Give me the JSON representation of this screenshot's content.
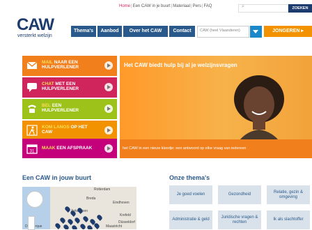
{
  "toplinks": [
    {
      "label": "Home",
      "active": true
    },
    {
      "label": "Een CAW in je buurt",
      "active": false
    },
    {
      "label": "Materiaal",
      "active": false
    },
    {
      "label": "Pers",
      "active": false
    },
    {
      "label": "FAQ",
      "active": false
    }
  ],
  "search": {
    "placeholder": "",
    "button_label": "ZOEKEN"
  },
  "logo": {
    "name": "CAW",
    "tagline": "versterkt welzijn"
  },
  "nav": {
    "items": [
      "Thema's",
      "Aanbod",
      "Over het CAW",
      "Contact"
    ],
    "select_value": "CAW (heel Vlaanderen)",
    "jongeren_label": "JONGEREN"
  },
  "contact_bars": [
    {
      "highlight": "MAIL",
      "rest1": " NAAR EEN",
      "line2": "HULPVERLENER",
      "color": "#f07f1c",
      "icon": "mail-icon"
    },
    {
      "highlight": "CHAT",
      "rest1": " MET EEN",
      "line2": "HULPVERLENER",
      "color": "#d0245d",
      "icon": "chat-icon"
    },
    {
      "highlight": "BEL",
      "rest1": " EEN",
      "line2": "HULPVERLENER",
      "color": "#9dc21a",
      "icon": "phone-icon"
    },
    {
      "highlight": "KOM LANGS",
      "rest1": " OP HET",
      "line2": "CAW",
      "color": "#f39200",
      "icon": "walk-icon"
    },
    {
      "highlight": "MAAK",
      "rest1": " EEN AFSPRAAK",
      "line2": "",
      "color": "#c4007a",
      "icon": "calendar-icon"
    }
  ],
  "hero": {
    "title": "Het CAW biedt hulp bij al je welzijnsvragen",
    "caption": "het CAW in een nieuw kleedje: een antwoord op elke vraag van iedereen"
  },
  "sections": {
    "map_title": "Een CAW in jouw buurt",
    "themes_title": "Onze thema's"
  },
  "map_labels": [
    "Rotterdam",
    "Breda",
    "Eindhoven",
    "Antwerpen",
    "Krefeld",
    "Düsseldorf",
    "Dunkerque",
    "Maastricht"
  ],
  "themes": [
    "Je goed voelen",
    "Gezondheid",
    "Relatie, gezin & omgeving",
    "Administratie & geld",
    "Juridische vragen & rechten",
    "Ik als slachtoffer"
  ],
  "colors": {
    "navy": "#1d3b6c",
    "nav_blue": "#2a5a8c",
    "orange": "#f39200",
    "pink": "#d0245d",
    "green": "#9dc21a",
    "magenta": "#c4007a"
  }
}
